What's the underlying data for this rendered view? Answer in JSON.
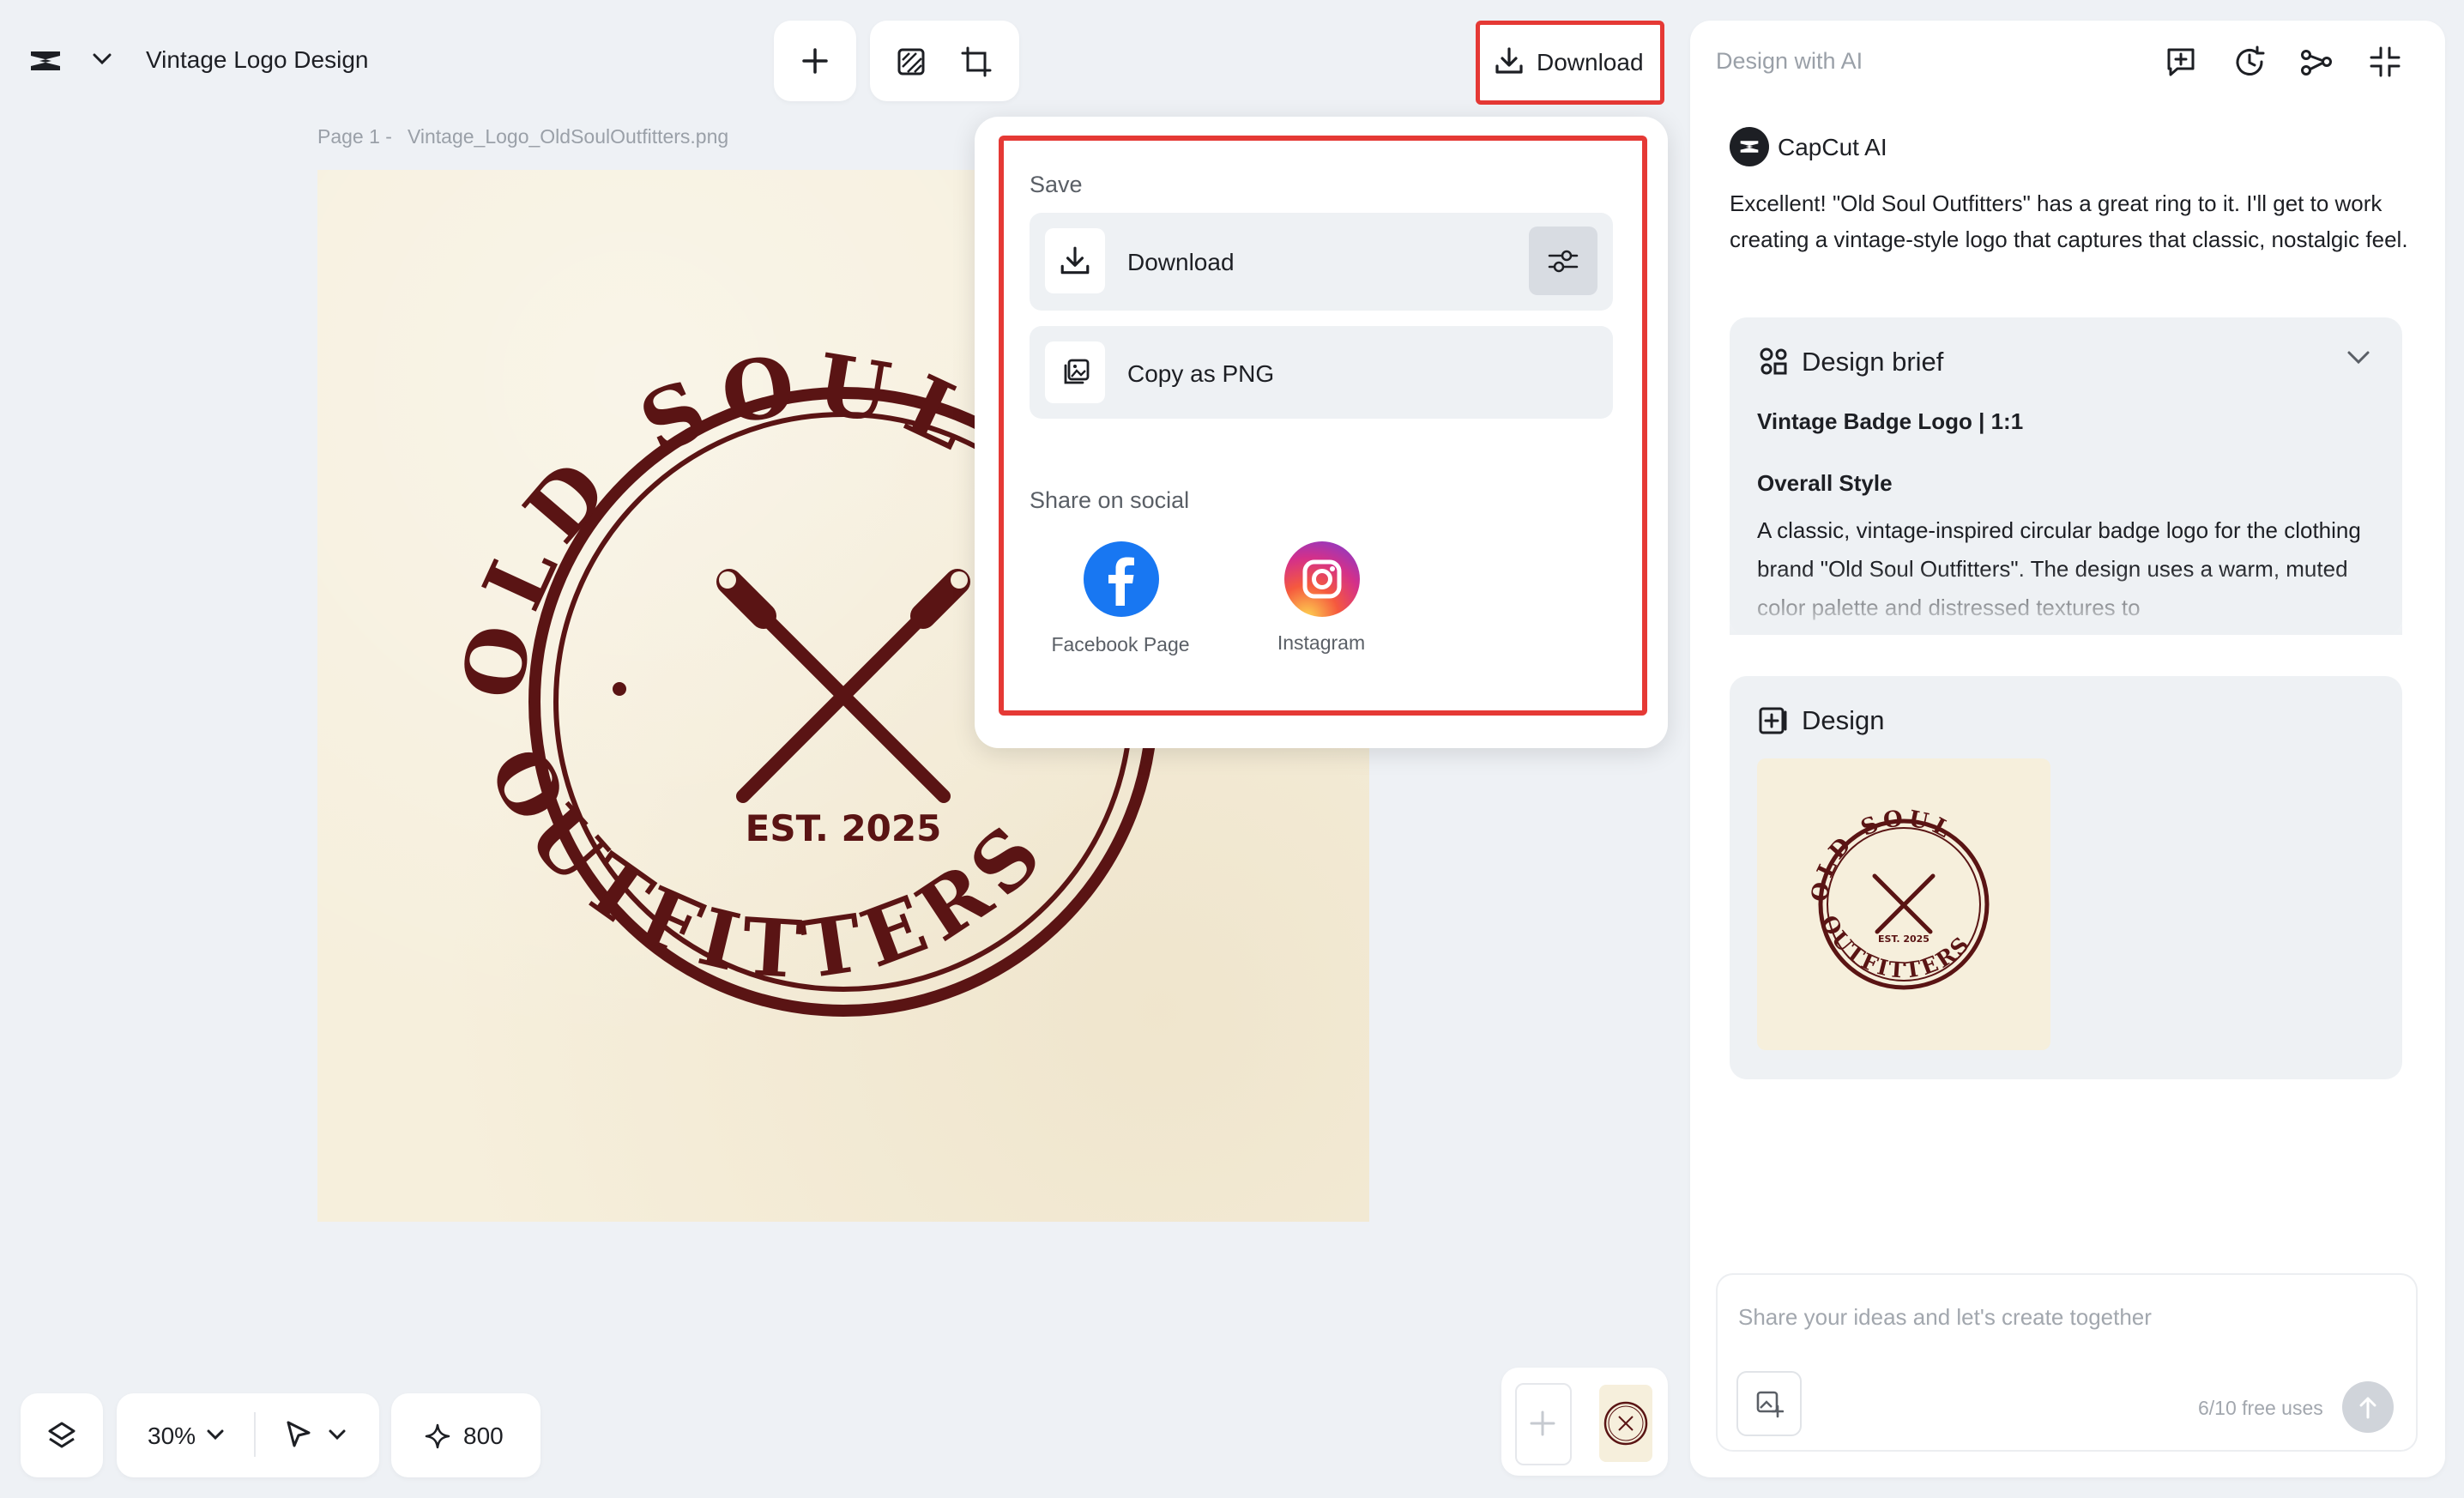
{
  "header": {
    "doc_title": "Vintage Logo Design",
    "download_label": "Download"
  },
  "canvas": {
    "page_label": "Page 1 -",
    "file_name": "Vintage_Logo_OldSoulOutfitters.png",
    "logo": {
      "top_text": "OLD SOUL",
      "bottom_text": "OUTFITTERS",
      "established": "EST. 2025",
      "color": "#5a1414",
      "background": "#f6efdc"
    }
  },
  "dropdown": {
    "save_title": "Save",
    "download_label": "Download",
    "copy_label": "Copy as PNG",
    "share_title": "Share on social",
    "facebook_label": "Facebook Page",
    "instagram_label": "Instagram"
  },
  "ai_panel": {
    "title": "Design with AI",
    "assistant_name": "CapCut AI",
    "message": "Excellent! \"Old Soul Outfitters\" has a great ring to it. I'll get to work creating a vintage-style logo that captures that classic, nostalgic feel.",
    "brief": {
      "title": "Design brief",
      "subtitle": "Vintage Badge Logo | 1:1",
      "style_heading": "Overall Style",
      "body": "A classic, vintage-inspired circular badge logo for the clothing brand \"Old Soul Outfitters\". The design uses a warm, muted color palette and distressed textures to"
    },
    "design_title": "Design",
    "prompt_placeholder": "Share your ideas and let's create together",
    "free_uses": "6/10 free uses"
  },
  "bottom_bar": {
    "zoom": "30%",
    "credits": "800"
  },
  "colors": {
    "accent_red": "#e53935",
    "facebook_blue": "#1877f2",
    "logo_brown": "#5a1414"
  }
}
